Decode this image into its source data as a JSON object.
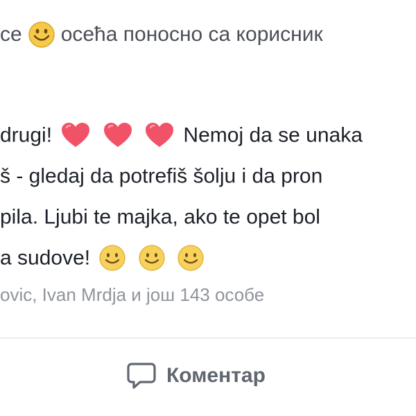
{
  "header": {
    "prefix": "се",
    "text": "осећа поносно са корисник"
  },
  "post": {
    "lines": [
      {
        "before": "drugi!",
        "after": "Nemoj da se unaka"
      },
      {
        "text": "š - gledaj da potrefiš šolju i da pron"
      },
      {
        "text": "pila. Ljubi te majka, ako te opet bol"
      },
      {
        "text": "a sudove!"
      }
    ]
  },
  "reactions": {
    "likes_text": "ovic, Ivan Mrdja и још 143 особе"
  },
  "actions": {
    "comment_label": "Коментар"
  },
  "colors": {
    "heart": "#f25268",
    "smile": "#f7c948",
    "text": "#1d2129",
    "muted": "#90949c",
    "action": "#606770"
  }
}
